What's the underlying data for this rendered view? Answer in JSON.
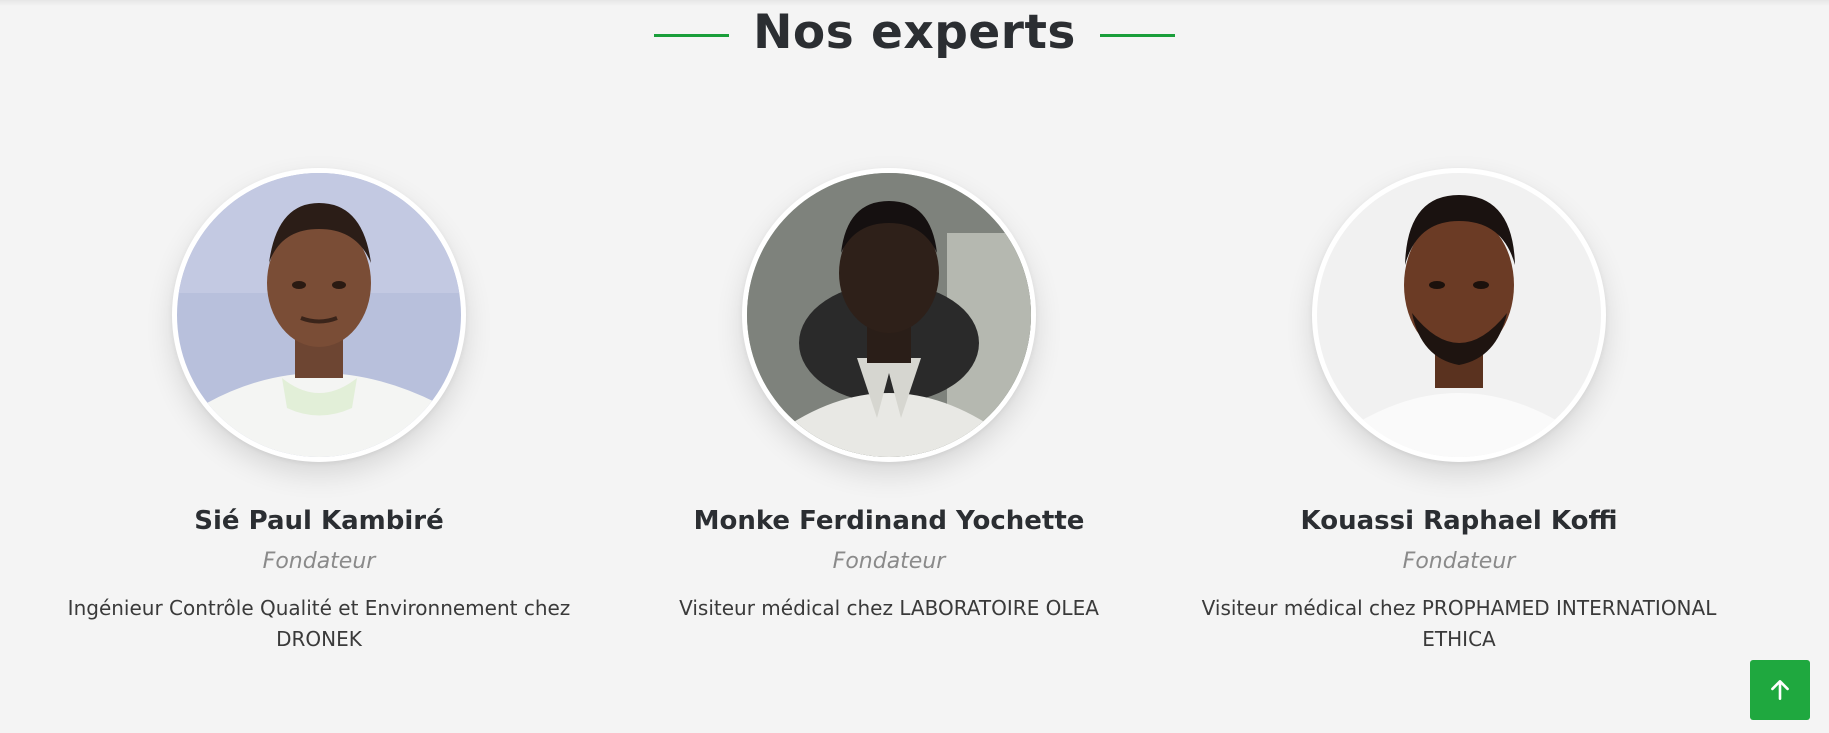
{
  "section": {
    "title": "Nos experts",
    "accent_color": "#1a9e3a"
  },
  "experts": [
    {
      "name": "Sié Paul Kambiré",
      "role": "Fondateur",
      "description": "Ingénieur Contrôle Qualité et Environnement chez DRONEK"
    },
    {
      "name": "Monke Ferdinand Yochette",
      "role": "Fondateur",
      "description": "Visiteur médical chez LABORATOIRE OLEA"
    },
    {
      "name": "Kouassi Raphael Koffi",
      "role": "Fondateur",
      "description": "Visiteur médical chez PROPHAMED INTERNATIONAL ETHICA"
    }
  ],
  "back_to_top": {
    "icon": "arrow-up-icon",
    "color": "#1fa83f"
  }
}
